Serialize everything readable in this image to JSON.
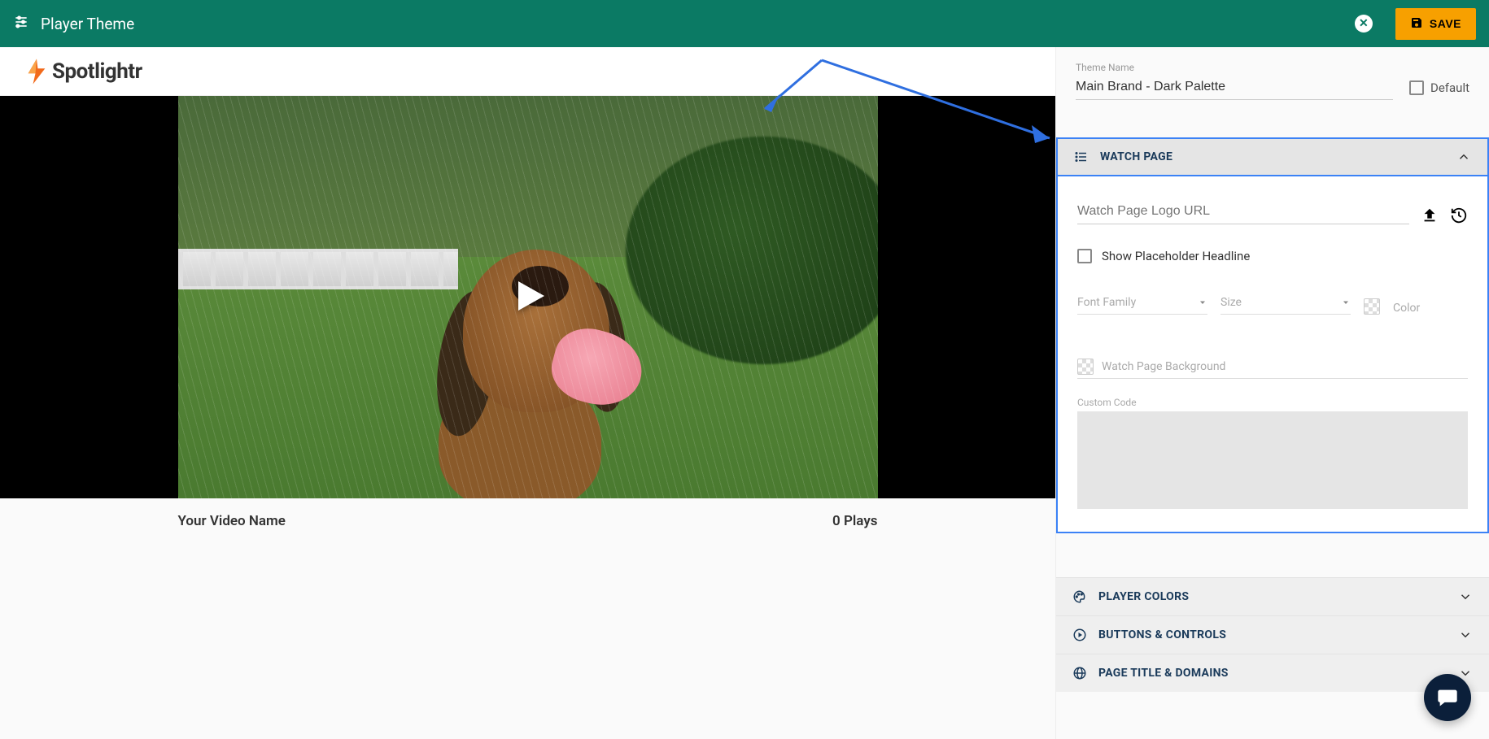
{
  "topbar": {
    "title": "Player Theme",
    "save_label": "SAVE"
  },
  "logo": {
    "text": "Spotlightr"
  },
  "preview": {
    "video_name": "Your Video Name",
    "plays_text": "0 Plays"
  },
  "sidebar": {
    "theme_name_label": "Theme Name",
    "theme_name_value": "Main Brand - Dark Palette",
    "default_label": "Default",
    "panels": {
      "watch_page": {
        "title": "WATCH PAGE",
        "logo_url_placeholder": "Watch Page Logo URL",
        "show_placeholder_headline": "Show Placeholder Headline",
        "font_family_label": "Font Family",
        "size_label": "Size",
        "color_label": "Color",
        "background_label": "Watch Page Background",
        "custom_code_label": "Custom Code"
      },
      "player_colors": {
        "title": "PLAYER COLORS"
      },
      "buttons_controls": {
        "title": "BUTTONS & CONTROLS"
      },
      "page_title_domains": {
        "title": "PAGE TITLE & DOMAINS"
      }
    }
  }
}
